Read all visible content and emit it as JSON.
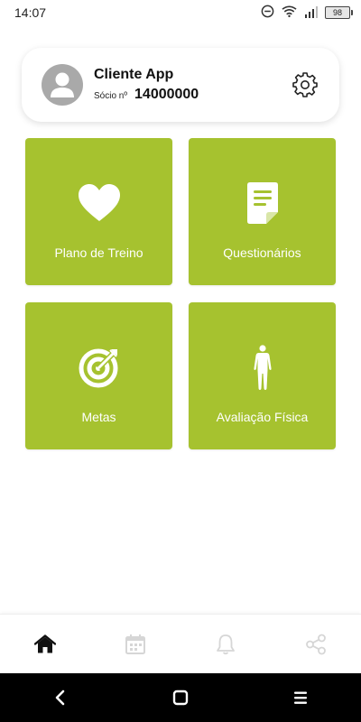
{
  "status_bar": {
    "time": "14:07",
    "battery": "98"
  },
  "profile": {
    "name": "Cliente App",
    "member_label": "Sócio nº",
    "member_number": "14000000"
  },
  "tiles": [
    {
      "label": "Plano de Treino",
      "icon": "heart-icon"
    },
    {
      "label": "Questionários",
      "icon": "document-icon"
    },
    {
      "label": "Metas",
      "icon": "target-icon"
    },
    {
      "label": "Avaliação Física",
      "icon": "body-icon"
    }
  ],
  "bottom_nav": {
    "items": [
      "home-icon",
      "calendar-icon",
      "bell-icon",
      "share-icon"
    ],
    "active": "home-icon"
  },
  "colors": {
    "tile": "#a6c22f",
    "nav_active": "#111111",
    "nav_inactive": "#d6d6d6"
  }
}
